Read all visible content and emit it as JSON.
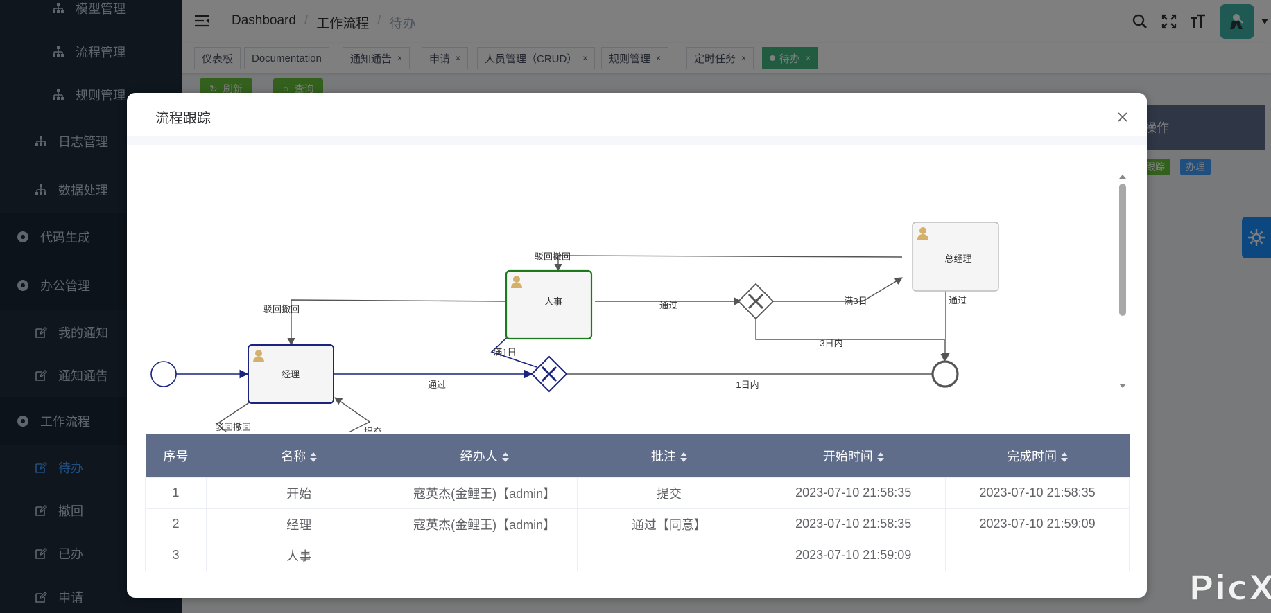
{
  "sidebar": {
    "items": [
      {
        "label": "模型管理",
        "icon": "sitemap-icon"
      },
      {
        "label": "流程管理",
        "icon": "sitemap-icon"
      },
      {
        "label": "规则管理",
        "icon": "sitemap-icon"
      },
      {
        "label": "日志管理",
        "icon": "sitemap-icon"
      },
      {
        "label": "数据处理",
        "icon": "sitemap-icon"
      },
      {
        "label": "代码生成",
        "icon": "gear-circle-icon"
      },
      {
        "label": "办公管理",
        "icon": "gear-circle-icon"
      },
      {
        "label": "我的通知",
        "icon": "edit-icon"
      },
      {
        "label": "通知通告",
        "icon": "edit-icon"
      },
      {
        "label": "工作流程",
        "icon": "gear-circle-icon"
      },
      {
        "label": "待办",
        "icon": "edit-icon",
        "active": true
      },
      {
        "label": "撤回",
        "icon": "edit-icon"
      },
      {
        "label": "已办",
        "icon": "edit-icon"
      },
      {
        "label": "申请",
        "icon": "edit-icon"
      }
    ]
  },
  "header": {
    "breadcrumb": [
      "Dashboard",
      "工作流程",
      "待办"
    ],
    "separator": "/"
  },
  "tags": [
    {
      "label": "仪表板",
      "closable": false
    },
    {
      "label": "Documentation",
      "closable": false
    },
    {
      "label": "通知通告",
      "closable": true
    },
    {
      "label": "申请",
      "closable": true
    },
    {
      "label": "人员管理（CRUD）",
      "closable": true
    },
    {
      "label": "规则管理",
      "closable": true
    },
    {
      "label": "定时任务",
      "closable": true
    },
    {
      "label": "待办",
      "closable": true,
      "active": true
    }
  ],
  "tag_close": "×",
  "page": {
    "refresh_label": "刷新",
    "query_label": "查询",
    "op_header": "操作",
    "track_label": "跟踪",
    "handle_label": "办理"
  },
  "dialog": {
    "title": "流程跟踪",
    "diagram": {
      "nodes": {
        "manager": "经理",
        "hr": "人事",
        "gm": "总经理"
      },
      "edge_labels": {
        "reject_left": "驳回撤回",
        "reject_top": "驳回撤回",
        "reject_bottom": "驳回撤回",
        "submit": "提交",
        "pass_main": "通过",
        "full_1_day": "满1日",
        "within_1_day": "1日内",
        "pass_hr": "通过",
        "full_3_days": "满3日",
        "within_3_days": "3日内",
        "pass_gm": "通过"
      }
    },
    "table": {
      "headers": [
        "序号",
        "名称",
        "经办人",
        "批注",
        "开始时间",
        "完成时间"
      ],
      "rows": [
        [
          "1",
          "开始",
          "寇英杰(金鲤王)【admin】",
          "提交",
          "2023-07-10 21:58:35",
          "2023-07-10 21:58:35"
        ],
        [
          "2",
          "经理",
          "寇英杰(金鲤王)【admin】",
          "通过【同意】",
          "2023-07-10 21:58:35",
          "2023-07-10 21:59:09"
        ],
        [
          "3",
          "人事",
          "",
          "",
          "2023-07-10 21:59:09",
          ""
        ]
      ]
    }
  },
  "watermark": "PicX",
  "colors": {
    "sidebar_bg": "#1f2d3d",
    "active_blue": "#409eff",
    "tag_active": "#42b983",
    "table_header": "#5f6d8a",
    "flow_done": "#1a237e",
    "node_active": "#1b7a1b"
  }
}
